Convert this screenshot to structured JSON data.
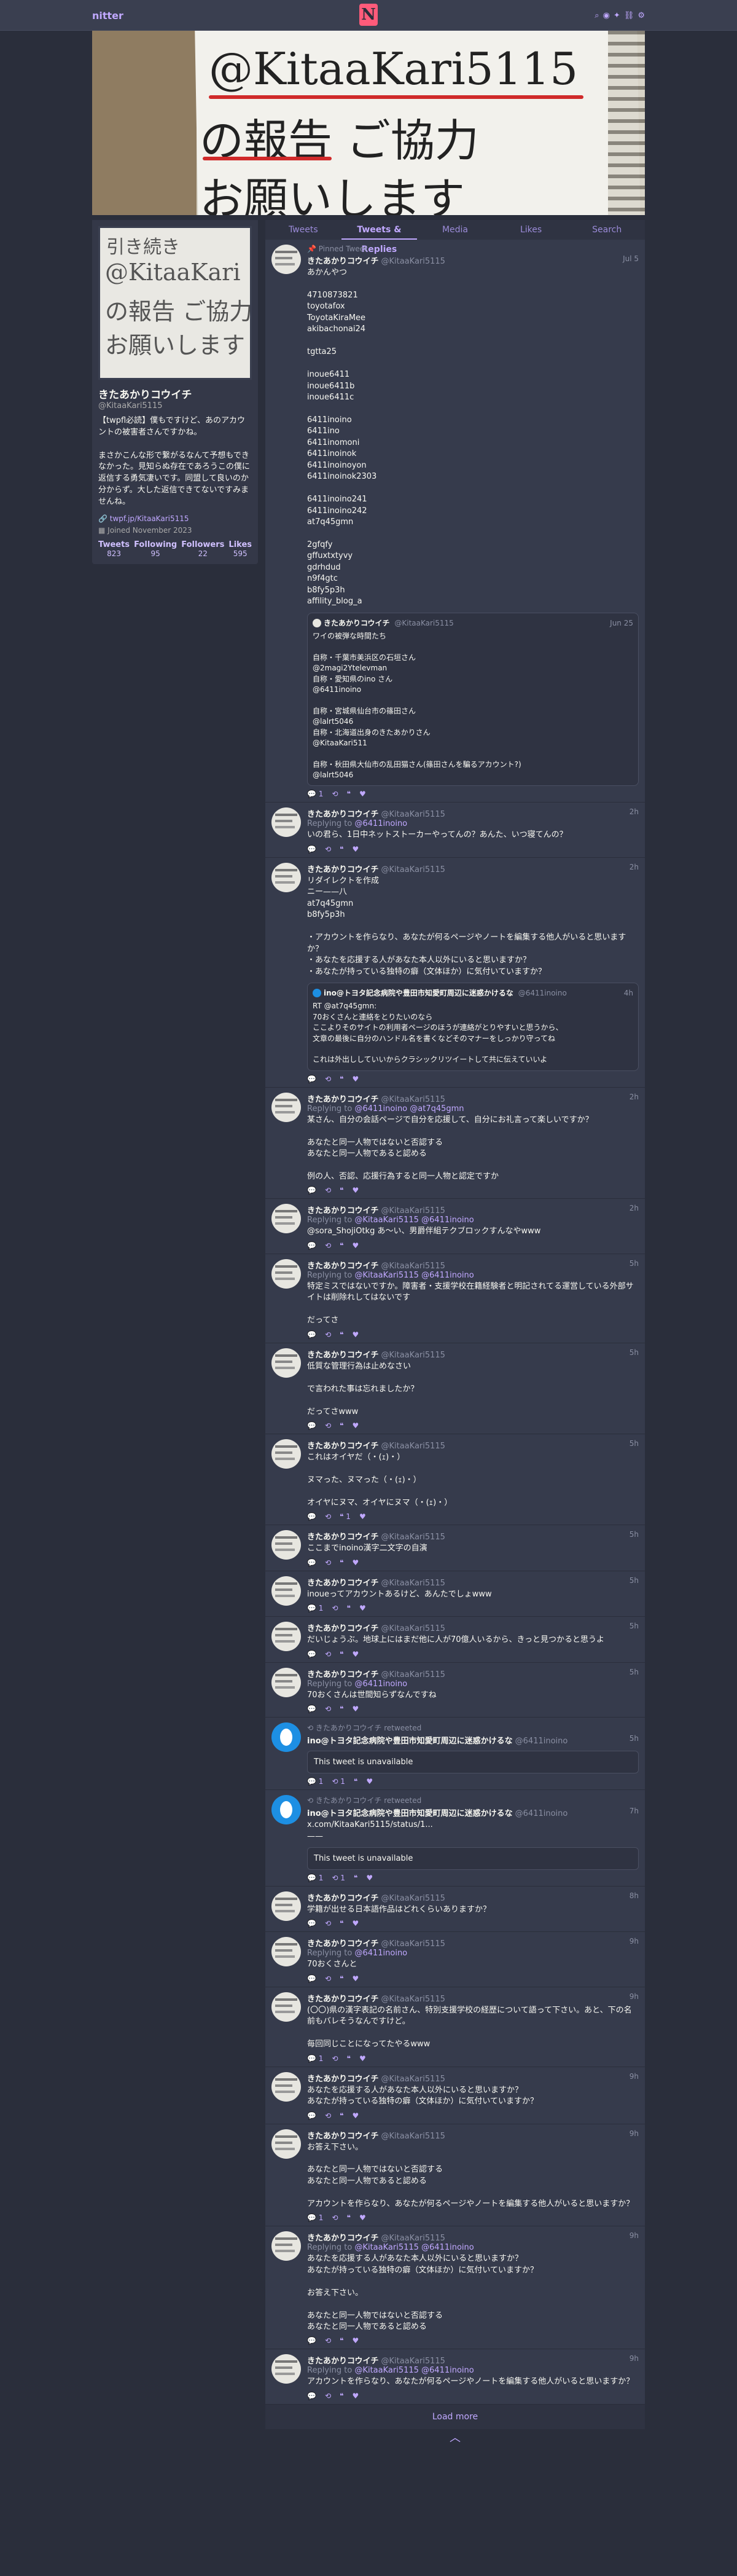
{
  "nav": {
    "brand": "nitter",
    "logo": "N",
    "icons": [
      "search-icon",
      "rss-icon",
      "twitter-icon",
      "link-icon",
      "gear-icon"
    ]
  },
  "banner": {
    "line1": "@KitaaKari5115",
    "line2": "の報告 ご協力",
    "line3": "お願いします"
  },
  "avatar_lettering": {
    "line1": "引き続き",
    "line2": "@KitaaKari",
    "line3": "の報告 ご協力",
    "line4": "お願いします"
  },
  "profile": {
    "name": "きたあかりコウイチ",
    "handle": "@KitaaKari5115",
    "bio": "【twpfl必読】僕もですけど、あのアカウントの被害者さんですかね。\n\nまさかこんな形で繋がるなんて予想もできなかった。見知らぬ存在であろうこの僕に返信する勇気凄いです。同盟して良いのか分からず。大した返信できてないですみませんね。",
    "link": "twpf.jp/KitaaKari5115",
    "joined": "Joined November 2023",
    "stats": [
      {
        "label": "Tweets",
        "value": "823"
      },
      {
        "label": "Following",
        "value": "95"
      },
      {
        "label": "Followers",
        "value": "22"
      },
      {
        "label": "Likes",
        "value": "595"
      }
    ]
  },
  "tabs": [
    "Tweets",
    "Tweets & Replies",
    "Media",
    "Likes",
    "Search"
  ],
  "tweets": [
    {
      "pinned": "Pinned Tweet",
      "name": "きたあかりコウイチ",
      "user": "@KitaaKari5115",
      "date": "Jul 5",
      "text": "あかんやつ\n\n4710873821\ntoyotafox\nToyotaKiraMee\nakibachonai24\n\ntgtta25\n\ninoue6411\ninoue6411b\ninoue6411c\n\n6411inoino\n6411ino\n6411inomoni\n6411inoinok\n6411inoinoyon\n6411inoinok2303\n\n6411inoino241\n6411inoino242\nat7q45gmn\n\n2gfqfy\ngffuxtxtyvy\ngdrhdud\nn9f4gtc\nb8fy5p3h\naffility_blog_a",
      "quote": {
        "name": "きたあかりコウイチ",
        "user": "@KitaaKari5115",
        "date": "Jun 25",
        "text": "ワイの被弾な時間たち\n\n自称・千葉市美浜区の石垣さん\n@2magi2Ytelevman\n自称・愛知県のino さん\n@6411inoino\n\n自称・宮城県仙台市の篠田さん\n@lalrt5046\n自称・北海道出身のきたあかりさん\n@KitaaKari511\n\n自称・秋田県大仙市の乱田猫さん(篠田さんを騙るアカウント?)\n@lalrt5046"
      },
      "stats": {
        "replies": "1",
        "retweets": "",
        "quotes": "",
        "likes": ""
      }
    },
    {
      "name": "きたあかりコウイチ",
      "user": "@KitaaKari5115",
      "date": "2h",
      "reply_label": "Replying to",
      "reply_to": "@6411inoino",
      "text": "いの君ら、1日中ネットストーカーやってんの？あんた、いつ寝てんの？",
      "stats": {
        "replies": "",
        "retweets": "",
        "quotes": "",
        "likes": ""
      }
    },
    {
      "name": "きたあかりコウイチ",
      "user": "@KitaaKari5115",
      "date": "2h",
      "text": "リダイレクトを作成\nニー——八\nat7q45gmn\nb8fy5p3h\n\n・アカウントを作らなり、あなたが何るページやノートを編集する他人がいると思いますか？\n・あなたを応援する人があなた本人以外にいると思いますか？\n・あなたが持っている独特の癖（文体ほか）に気付いていますか？",
      "quote": {
        "name": "ino@トヨタ記念病院や豊田市知愛町周辺に迷惑かけるな",
        "user": "@6411inoino",
        "date": "4h",
        "blue": true,
        "text": "RT @at7q45gmn:\n70おくさんと連絡をとりたいのなら\nここよりそのサイトの利用者ページのほうが連絡がとりやすいと思うから、\n文章の最後に自分のハンドル名を書くなどそのマナーをしっかり守ってね\n\nこれは外出ししていいからクラシックリツイートして共に伝えていいよ"
      },
      "stats": {
        "replies": "",
        "retweets": "",
        "quotes": "",
        "likes": ""
      }
    },
    {
      "name": "きたあかりコウイチ",
      "user": "@KitaaKari5115",
      "date": "2h",
      "reply_label": "Replying to",
      "reply_to": "@6411inoino @at7q45gmn",
      "text": "某さん、自分の会話ページで自分を応援して、自分にお礼言って楽しいですか？\n\nあなたと同一人物ではないと否認する\nあなたと同一人物であると認める\n\n例の人、否認、応援行為すると同一人物と認定ですか",
      "stats": {
        "replies": "",
        "retweets": "",
        "quotes": "",
        "likes": ""
      }
    },
    {
      "name": "きたあかりコウイチ",
      "user": "@KitaaKari5115",
      "date": "2h",
      "reply_label": "Replying to",
      "reply_to": "@KitaaKari5115 @6411inoino",
      "text": "@sora_ShojiOtkg あ〜い、男爵伴組テクブロックすんなやwww",
      "stats": {
        "replies": "",
        "retweets": "",
        "quotes": "",
        "likes": ""
      }
    },
    {
      "name": "きたあかりコウイチ",
      "user": "@KitaaKari5115",
      "date": "5h",
      "reply_label": "Replying to",
      "reply_to": "@KitaaKari5115 @6411inoino",
      "text": "特定ミスではないですか。障害者・支援学校在籍経験者と明記されてる運営している外部サイトは削除れしてはないです\n\nだってさ",
      "stats": {
        "replies": "",
        "retweets": "",
        "quotes": "",
        "likes": ""
      }
    },
    {
      "name": "きたあかりコウイチ",
      "user": "@KitaaKari5115",
      "date": "5h",
      "text": "低質な管理行為は止めなさい\n\nで言われた事は忘れましたか？\n\nだってさwww",
      "stats": {
        "replies": "",
        "retweets": "",
        "quotes": "",
        "likes": ""
      }
    },
    {
      "name": "きたあかりコウイチ",
      "user": "@KitaaKari5115",
      "date": "5h",
      "text": "これはオイヤだ（・(ｪ)・）\n\nヌマった、ヌマった（・(ｪ)・）\n\nオイヤにヌマ、オイヤにヌマ（・(ｪ)・）",
      "stats": {
        "replies": "",
        "retweets": "",
        "quotes": "1",
        "likes": ""
      }
    },
    {
      "name": "きたあかりコウイチ",
      "user": "@KitaaKari5115",
      "date": "5h",
      "text": "ここまでinoino漢字二文字の自演",
      "stats": {
        "replies": "",
        "retweets": "",
        "quotes": "",
        "likes": ""
      }
    },
    {
      "name": "きたあかりコウイチ",
      "user": "@KitaaKari5115",
      "date": "5h",
      "text": "inoueってアカウントあるけど、あんたでしょwww",
      "stats": {
        "replies": "1",
        "retweets": "",
        "quotes": "",
        "likes": ""
      }
    },
    {
      "name": "きたあかりコウイチ",
      "user": "@KitaaKari5115",
      "date": "5h",
      "text": "だいじょうぶ。地球上にはまだ他に人が70億人いるから、きっと見つかると思うよ",
      "stats": {
        "replies": "",
        "retweets": "",
        "quotes": "",
        "likes": ""
      }
    },
    {
      "name": "きたあかりコウイチ",
      "user": "@KitaaKari5115",
      "date": "5h",
      "reply_label": "Replying to",
      "reply_to": "@6411inoino",
      "text": "70おくさんは世間知らずなんですね",
      "stats": {
        "replies": "",
        "retweets": "",
        "quotes": "",
        "likes": ""
      }
    },
    {
      "retweet": "きたあかりコウイチ retweeted",
      "blue": true,
      "name": "ino@トヨタ記念病院や豊田市知愛町周辺に迷惑かけるな",
      "user": "@6411inoino",
      "date": "5h",
      "text": "",
      "unavailable": "This tweet is unavailable",
      "stats": {
        "replies": "1",
        "retweets": "1",
        "quotes": "",
        "likes": ""
      }
    },
    {
      "retweet": "きたあかりコウイチ retweeted",
      "blue": true,
      "name": "ino@トヨタ記念病院や豊田市知愛町周辺に迷惑かけるな",
      "user": "@6411inoino",
      "date": "7h",
      "text": "x.com/KitaaKari5115/status/1...\n——",
      "unavailable": "This tweet is unavailable",
      "stats": {
        "replies": "1",
        "retweets": "1",
        "quotes": "",
        "likes": ""
      }
    },
    {
      "name": "きたあかりコウイチ",
      "user": "@KitaaKari5115",
      "date": "8h",
      "text": "学籍が出せる日本語作品はどれくらいありますか？",
      "stats": {
        "replies": "",
        "retweets": "",
        "quotes": "",
        "likes": ""
      }
    },
    {
      "name": "きたあかりコウイチ",
      "user": "@KitaaKari5115",
      "date": "9h",
      "reply_label": "Replying to",
      "reply_to": "@6411inoino",
      "text": "70おくさんと",
      "stats": {
        "replies": "",
        "retweets": "",
        "quotes": "",
        "likes": ""
      }
    },
    {
      "name": "きたあかりコウイチ",
      "user": "@KitaaKari5115",
      "date": "9h",
      "text": "(〇〇)県の漢字表記の名前さん、特別支援学校の経歴について語って下さい。あと、下の名前もバレそうなんですけど。\n\n毎回同じことになってたやるwww",
      "stats": {
        "replies": "1",
        "retweets": "",
        "quotes": "",
        "likes": ""
      }
    },
    {
      "name": "きたあかりコウイチ",
      "user": "@KitaaKari5115",
      "date": "9h",
      "text": "あなたを応援する人があなた本人以外にいると思いますか？\nあなたが持っている独特の癖（文体ほか）に気付いていますか？",
      "stats": {
        "replies": "",
        "retweets": "",
        "quotes": "",
        "likes": ""
      }
    },
    {
      "name": "きたあかりコウイチ",
      "user": "@KitaaKari5115",
      "date": "9h",
      "text": "お答え下さい。\n\nあなたと同一人物ではないと否認する\nあなたと同一人物であると認める\n\nアカウントを作らなり、あなたが何るページやノートを編集する他人がいると思いますか？",
      "stats": {
        "replies": "1",
        "retweets": "",
        "quotes": "",
        "likes": ""
      }
    },
    {
      "name": "きたあかりコウイチ",
      "user": "@KitaaKari5115",
      "date": "9h",
      "reply_label": "Replying to",
      "reply_to": "@KitaaKari5115 @6411inoino",
      "text": "あなたを応援する人があなた本人以外にいると思いますか？\nあなたが持っている独特の癖（文体ほか）に気付いていますか？\n\nお答え下さい。\n\nあなたと同一人物ではないと否認する\nあなたと同一人物であると認める",
      "stats": {
        "replies": "",
        "retweets": "",
        "quotes": "",
        "likes": ""
      }
    },
    {
      "name": "きたあかりコウイチ",
      "user": "@KitaaKari5115",
      "date": "9h",
      "reply_label": "Replying to",
      "reply_to": "@KitaaKari5115 @6411inoino",
      "text": "アカウントを作らなり、あなたが何るページやノートを編集する他人がいると思いますか？",
      "stats": {
        "replies": "",
        "retweets": "",
        "quotes": "",
        "likes": ""
      }
    }
  ],
  "load_more": "Load more",
  "footer": "︿",
  "colors": {
    "bg": "#2a2e3b",
    "card": "#363b4c",
    "accent": "#c0a8ff",
    "logo": "#ff5b7a"
  }
}
